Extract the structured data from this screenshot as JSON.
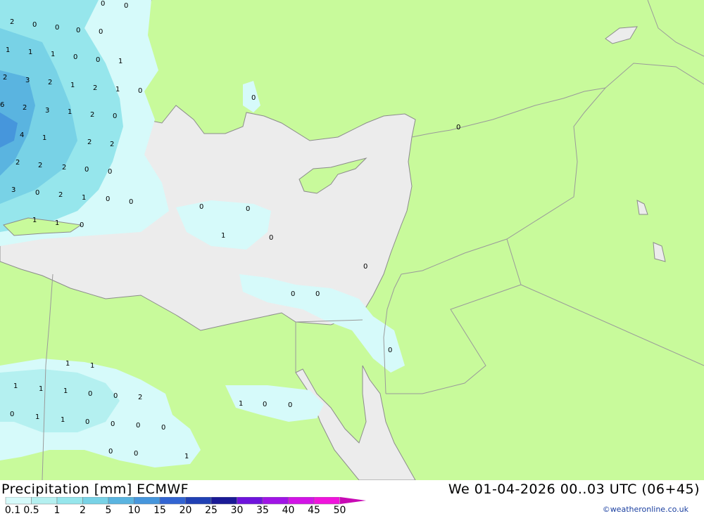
{
  "header": {
    "title": "Precipitation [mm] ECMWF",
    "datetime": "We 01-04-2026 00..03 UTC (06+45)",
    "credit": "©weatheronline.co.uk"
  },
  "colors": {
    "land": "#c8fa9b",
    "sea_dry": "#ececec",
    "border": "#9a9a9a",
    "coast": "#8c8c8c"
  },
  "legend": {
    "labels": [
      "0.1",
      "0.5",
      "1",
      "2",
      "5",
      "10",
      "15",
      "20",
      "25",
      "30",
      "35",
      "40",
      "45",
      "50"
    ],
    "colors": [
      "#d6fafa",
      "#b4f0f0",
      "#96e6ec",
      "#78d2e6",
      "#5ab4e0",
      "#4696dc",
      "#3264d2",
      "#2040b4",
      "#1a1a96",
      "#6e14dc",
      "#a014e6",
      "#d214e6",
      "#f014dc",
      "#c80ab4"
    ]
  },
  "map_labels": [
    {
      "text": "2"
    },
    {
      "text": "0"
    },
    {
      "text": "0"
    },
    {
      "text": "0"
    },
    {
      "text": "0"
    },
    {
      "text": "0"
    },
    {
      "text": "0"
    },
    {
      "text": "1"
    },
    {
      "text": "1"
    },
    {
      "text": "1"
    },
    {
      "text": "0"
    },
    {
      "text": "0"
    },
    {
      "text": "1"
    },
    {
      "text": "2"
    },
    {
      "text": "3"
    },
    {
      "text": "2"
    },
    {
      "text": "1"
    },
    {
      "text": "2"
    },
    {
      "text": "1"
    },
    {
      "text": "0"
    },
    {
      "text": "6"
    },
    {
      "text": "2"
    },
    {
      "text": "3"
    },
    {
      "text": "1"
    },
    {
      "text": "2"
    },
    {
      "text": "0"
    },
    {
      "text": "4"
    },
    {
      "text": "1"
    },
    {
      "text": "2"
    },
    {
      "text": "2"
    },
    {
      "text": "2"
    },
    {
      "text": "2"
    },
    {
      "text": "2"
    },
    {
      "text": "0"
    },
    {
      "text": "0"
    },
    {
      "text": "3"
    },
    {
      "text": "0"
    },
    {
      "text": "2"
    },
    {
      "text": "1"
    },
    {
      "text": "0"
    },
    {
      "text": "0"
    },
    {
      "text": "1"
    },
    {
      "text": "1"
    },
    {
      "text": "0"
    },
    {
      "text": "0"
    },
    {
      "text": "0"
    },
    {
      "text": "1"
    },
    {
      "text": "0"
    },
    {
      "text": "0"
    },
    {
      "text": "0"
    },
    {
      "text": "0"
    },
    {
      "text": "0"
    },
    {
      "text": "0"
    },
    {
      "text": "0"
    },
    {
      "text": "1"
    },
    {
      "text": "1"
    },
    {
      "text": "1"
    },
    {
      "text": "1"
    },
    {
      "text": "1"
    },
    {
      "text": "0"
    },
    {
      "text": "0"
    },
    {
      "text": "2"
    },
    {
      "text": "0"
    },
    {
      "text": "1"
    },
    {
      "text": "1"
    },
    {
      "text": "0"
    },
    {
      "text": "0"
    },
    {
      "text": "0"
    },
    {
      "text": "0"
    },
    {
      "text": "0"
    },
    {
      "text": "0"
    },
    {
      "text": "1"
    },
    {
      "text": "1"
    },
    {
      "text": "0"
    },
    {
      "text": "0"
    }
  ]
}
